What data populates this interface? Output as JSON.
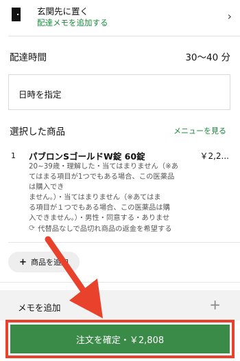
{
  "delivery_option": {
    "title": "玄関先に置く",
    "link": "配達メモを追加する"
  },
  "delivery_time": {
    "label": "配達時間",
    "value": "30〜40 分"
  },
  "schedule": {
    "label": "日時を指定"
  },
  "selected_items": {
    "header": "選択した商品",
    "view_menu": "メニューを見る",
    "items": [
      {
        "qty": "1",
        "name": "パブロンSゴールドW錠 60錠",
        "price": "￥2,2...",
        "desc_lines": [
          "20~39歳・理解した・当てはまりません（※あ",
          "てはまる項目が1つでもある場合、この医薬品",
          "は購入でき",
          "ません。）・当てはまりません（※あてはま",
          "る項目が１つでもある場合、この医薬品は購",
          "入できません。）・男性・同意する・ありませ"
        ],
        "substitution": "代替品なしで品切れ商品の返金を希望する"
      }
    ]
  },
  "add_item_label": "商品を追加",
  "memo": {
    "label": "メモを追加"
  },
  "confirm": {
    "label": "注文を確定・￥2,808"
  },
  "colors": {
    "accent_green": "#1a8a3c",
    "button_green": "#3a8a48",
    "annotation_red": "#e8412c"
  },
  "icons": {
    "door": "door-icon",
    "chevron": "chevron-right-icon",
    "refresh": "refresh-icon",
    "plus": "plus-icon",
    "arrow": "arrow-annotation"
  }
}
